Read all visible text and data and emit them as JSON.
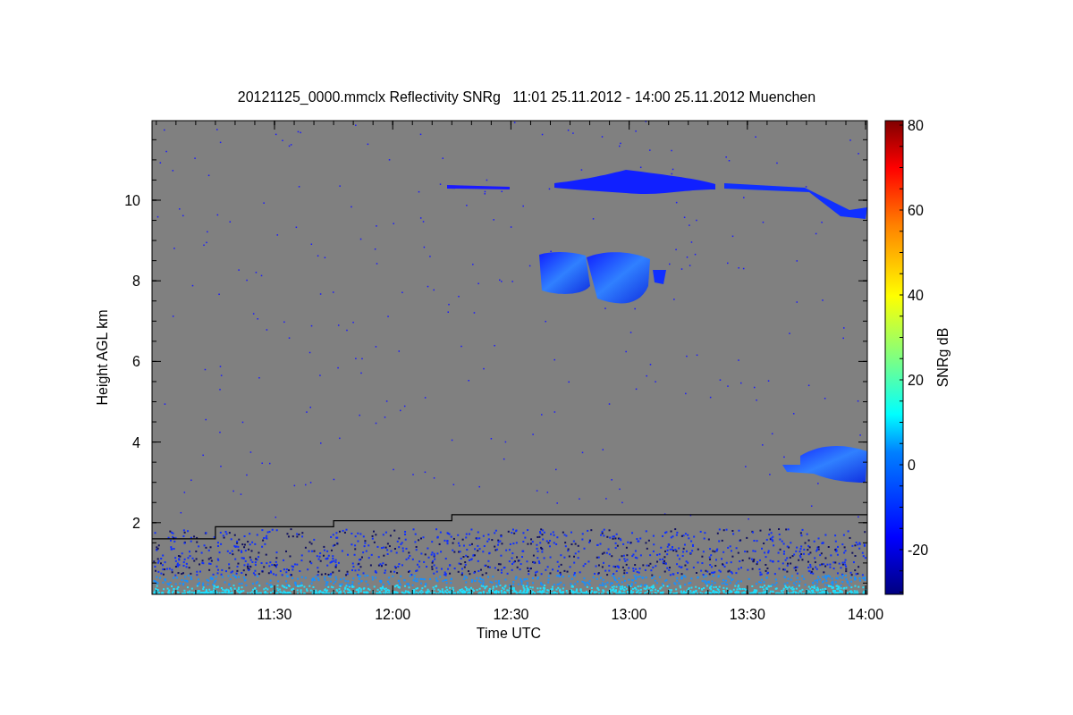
{
  "title": "20121125_0000.mmclx Reflectivity SNRg   11:01 25.11.2012 - 14:00 25.11.2012 Muenchen",
  "y_axis": {
    "label": "Height AGL km",
    "ticks": [
      "10",
      "8",
      "6",
      "4",
      "2"
    ]
  },
  "x_axis": {
    "label": "Time UTC",
    "ticks": [
      "11:30",
      "12:00",
      "12:30",
      "13:00",
      "13:30",
      "14:00"
    ]
  },
  "colorbar": {
    "label": "SNRg dB",
    "ticks": [
      "80",
      "60",
      "40",
      "20",
      "0",
      "-20"
    ]
  }
}
